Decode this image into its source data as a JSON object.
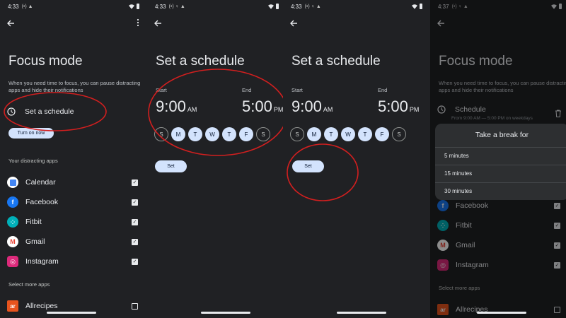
{
  "screens": [
    {
      "status": {
        "time": "4:33",
        "icons": "(•) ▲"
      },
      "title": "Focus mode",
      "description": "When you need time to focus, you can pause distracting apps and hide their notifications",
      "schedule_label": "Set a schedule",
      "turn_on_label": "Turn on now",
      "distracting_header": "Your distracting apps",
      "apps": [
        {
          "label": "Calendar",
          "checked": true
        },
        {
          "label": "Facebook",
          "checked": true
        },
        {
          "label": "Fitbit",
          "checked": true
        },
        {
          "label": "Gmail",
          "checked": true
        },
        {
          "label": "Instagram",
          "checked": true
        }
      ],
      "more_header": "Select more apps",
      "more_apps": [
        {
          "label": "Allrecipes",
          "icon_text": "ar",
          "checked": false
        }
      ]
    },
    {
      "status": {
        "time": "4:33",
        "icons": "(•) ♀ ▲"
      },
      "title": "Set a schedule",
      "start_label": "Start",
      "start_time": "9:00",
      "start_ampm": "AM",
      "end_label": "End",
      "end_time": "5:00",
      "end_ampm": "PM",
      "days": [
        "S",
        "M",
        "T",
        "W",
        "T",
        "F",
        "S"
      ],
      "days_selected": [
        false,
        true,
        true,
        true,
        true,
        true,
        false
      ],
      "set_label": "Set"
    },
    {
      "status": {
        "time": "4:33",
        "icons": "(•) ♀ ▲"
      },
      "title": "Set a schedule",
      "start_label": "Start",
      "start_time": "9:00",
      "start_ampm": "AM",
      "end_label": "End",
      "end_time": "5:00",
      "end_ampm": "PM",
      "days": [
        "S",
        "M",
        "T",
        "W",
        "T",
        "F",
        "S"
      ],
      "days_selected": [
        false,
        true,
        true,
        true,
        true,
        true,
        false
      ],
      "set_label": "Set"
    },
    {
      "status": {
        "time": "4:37",
        "icons": "(•) ♀ ▲"
      },
      "title": "Focus mode",
      "description": "When you need time to focus, you can pause distracting apps and hide their notifications",
      "schedule_label": "Schedule",
      "schedule_sub": "From 9:00 AM — 5:00 PM on weekdays",
      "dialog": {
        "title": "Take a break for",
        "options": [
          "5 minutes",
          "15 minutes",
          "30 minutes"
        ]
      },
      "apps": [
        {
          "label": "Facebook",
          "checked": true
        },
        {
          "label": "Fitbit",
          "checked": true
        },
        {
          "label": "Gmail",
          "checked": true
        },
        {
          "label": "Instagram",
          "checked": true
        }
      ],
      "more_header": "Select more apps",
      "more_apps": [
        {
          "label": "Allrecipes",
          "icon_text": "ar",
          "checked": false
        }
      ]
    }
  ],
  "colors": {
    "background": "#202124",
    "accent_button": "#d3e3fd",
    "annotation_red": "#d21f1f",
    "calendar_icon": "#4285f4",
    "facebook_icon": "#1877f2",
    "fitbit_icon": "#00b0b9",
    "gmail_icon": "#ea4335",
    "instagram_icon": "#dd2a7b",
    "allrecipes_icon": "#e8541e"
  },
  "icons": {
    "back": "arrow-left-icon",
    "more": "more-vert-icon",
    "clock": "clock-icon",
    "trash": "trash-icon",
    "wifi": "wifi-icon",
    "battery": "battery-icon"
  }
}
